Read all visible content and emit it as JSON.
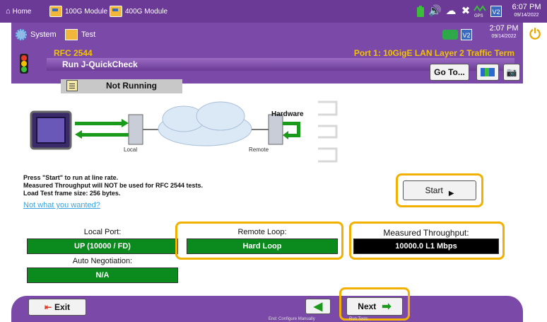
{
  "topbar": {
    "home_label": "Home",
    "module_100g": "100G Module",
    "module_400g": "400G Module",
    "module_icon_text": "BERT",
    "time": "6:07 PM",
    "date": "09/14/2022",
    "status_badge": "V2",
    "gps_label": "GPS"
  },
  "secondbar": {
    "system_label": "System",
    "test_label": "Test",
    "time": "2:07 PM",
    "date": "09/14/2022",
    "status_badge": "V2"
  },
  "header": {
    "rfc": "RFC 2544",
    "port": "Port 1: 10GigE LAN Layer 2 Traffic Term",
    "title": "Run J-QuickCheck",
    "goto_label": "Go To..."
  },
  "status": {
    "text": "Not Running"
  },
  "diagram": {
    "hardware_label": "Hardware",
    "local_label": "Local",
    "remote_label": "Remote"
  },
  "description": {
    "line1": "Press \"Start\" to run at line rate.",
    "line2": "Measured Throughput will NOT be used for RFC 2544 tests.",
    "line3": "Load Test frame size: 256 bytes.",
    "link": "Not what you wanted?"
  },
  "start_button": "Start",
  "fields": {
    "local_port_label": "Local Port:",
    "local_port_value": "UP (10000 / FD)",
    "remote_loop_label": "Remote Loop:",
    "remote_loop_value": "Hard Loop",
    "throughput_label": "Measured Throughput:",
    "throughput_value": "10000.0 L1 Mbps",
    "autoneg_label": "Auto Negotiation:",
    "autoneg_value": "N/A"
  },
  "bottom": {
    "exit_label": "Exit",
    "back_caption": "End: Configure Manually",
    "next_label": "Next",
    "next_caption": "Run Tests"
  },
  "colors": {
    "purple": "#7b4aa8",
    "green_value": "#0b8a1e",
    "highlight": "#f2b000",
    "rfc_yellow": "#f2c200"
  }
}
